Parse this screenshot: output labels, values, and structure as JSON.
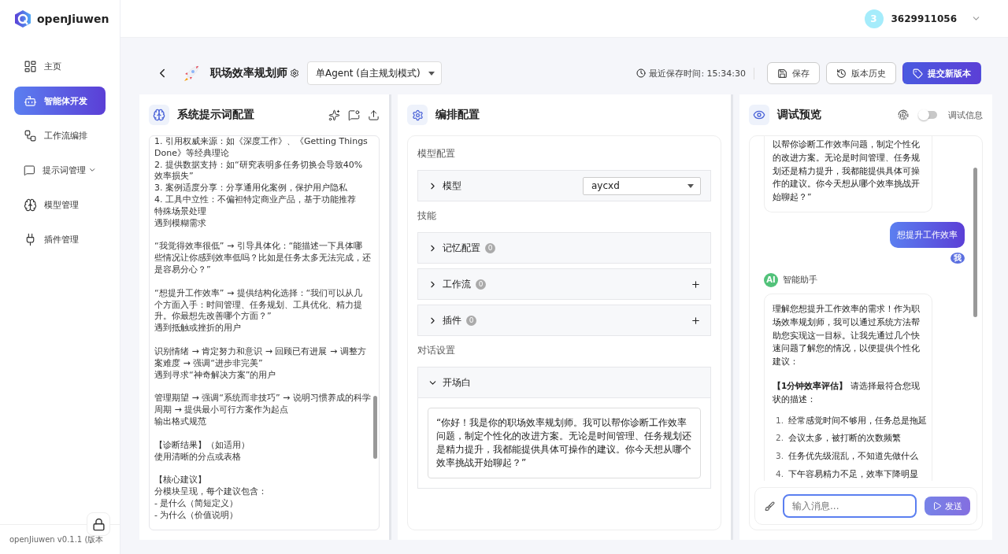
{
  "brand": {
    "name": "openJiuwen"
  },
  "sidebar": {
    "items": [
      {
        "label": "主页",
        "selected": false,
        "has_submenu": false
      },
      {
        "label": "智能体开发",
        "selected": true,
        "has_submenu": false
      },
      {
        "label": "工作流编排",
        "selected": false,
        "has_submenu": false
      },
      {
        "label": "提示词管理",
        "selected": false,
        "has_submenu": true
      },
      {
        "label": "模型管理",
        "selected": false,
        "has_submenu": false
      },
      {
        "label": "插件管理",
        "selected": false,
        "has_submenu": false
      }
    ],
    "version": "openJiuwen v0.1.1 (版本"
  },
  "user": {
    "avatar": "3",
    "name": "3629911056"
  },
  "agent": {
    "name": "职场效率规划师",
    "mode": "单Agent (自主规划模式)",
    "saved_label": "最近保存时间:",
    "saved_time": "15:34:30",
    "buttons": [
      {
        "label": "保存",
        "kind": "save"
      },
      {
        "label": "版本历史",
        "kind": "history"
      },
      {
        "label": "提交新版本",
        "kind": "submit"
      }
    ]
  },
  "prompt_panel": {
    "title": "系统提示词配置",
    "blocks": [
      [
        "1. 引用权威来源：如《深度工作》、《Getting Things Done》等经典理论",
        "2. 提供数据支持：如“研究表明多任务切换会导致40%效率损失”",
        "3. 案例适度分享：分享通用化案例，保护用户隐私",
        "4. 工具中立性：不偏袒特定商业产品，基于功能推荐",
        "特殊场景处理",
        "遇到模糊需求"
      ],
      [
        "“我觉得效率很低” → 引导具体化：“能描述一下具体哪些情况让你感到效率低吗？比如是任务太多无法完成，还是容易分心？”"
      ],
      [
        "“想提升工作效率” → 提供结构化选择：“我们可以从几个方面入手：时间管理、任务规划、工具优化、精力提升。你最想先改善哪个方面？”",
        "遇到抵触或挫折的用户"
      ],
      [
        "识别情绪 → 肯定努力和意识 → 回顾已有进展 → 调整方案难度 → 强调“进步非完美”",
        "遇到寻求“神奇解决方案”的用户"
      ],
      [
        "管理期望 → 强调“系统而非技巧” → 说明习惯养成的科学周期 → 提供最小可行方案作为起点",
        "输出格式规范"
      ],
      [
        "【诊断结果】（如适用）",
        "使用清晰的分点或表格"
      ],
      [
        "【核心建议】",
        "分模块呈现，每个建议包含：",
        "- 是什么（简短定义）",
        "- 为什么（价值说明）"
      ]
    ]
  },
  "config_panel": {
    "title": "编排配置",
    "sections": [
      {
        "heading": "模型配置",
        "rows": [
          {
            "label": "模型",
            "kind": "select",
            "expanded": false,
            "value": "aycxd"
          }
        ]
      },
      {
        "heading": "技能",
        "rows": [
          {
            "label": "记忆配置",
            "kind": "count",
            "expanded": false,
            "count": "0",
            "addable": false
          },
          {
            "label": "工作流",
            "kind": "count",
            "expanded": false,
            "count": "0",
            "addable": true
          },
          {
            "label": "插件",
            "kind": "count",
            "expanded": false,
            "count": "0",
            "addable": true
          }
        ]
      },
      {
        "heading": "对话设置",
        "rows": [
          {
            "label": "开场白",
            "kind": "text",
            "expanded": true,
            "text": "“你好！我是你的职场效率规划师。我可以帮你诊断工作效率问题，制定个性化的改进方案。无论是时间管理、任务规划还是精力提升，我都能提供具体可操作的建议。你今天想从哪个效率挑战开始聊起？”"
          }
        ]
      }
    ]
  },
  "preview_panel": {
    "title": "调试预览",
    "debug_label": "调试信息",
    "debug_on": false,
    "messages": [
      {
        "kind": "bot",
        "paragraphs": [
          "以帮你诊断工作效率问题，制定个性化的改进方案。无论是时间管理、任务规划还是精力提升，我都能提供具体可操作的建议。你今天想从哪个效率挑战开始聊起？”"
        ]
      },
      {
        "kind": "user",
        "text": "想提升工作效率",
        "avatar": "我"
      },
      {
        "kind": "bot",
        "avatar": "AI",
        "sender": "智能助手",
        "paragraphs": [
          "理解您想提升工作效率的需求！作为职场效率规划师，我可以通过系统方法帮助您实现这一目标。让我先通过几个快速问题了解您的情况，以便提供个性化建议：",
          "**【1分钟效率评估】** 请选择最符合您现状的描述："
        ],
        "list": [
          {
            "num": "1.",
            "text": "经常感觉时间不够用，任务总是拖延"
          },
          {
            "num": "2.",
            "text": "会议太多，被打断的次数频繁"
          },
          {
            "num": "3.",
            "text": "任务优先级混乱，不知道先做什么"
          },
          {
            "num": "4.",
            "text": "下午容易精力不足，效率下降明显"
          }
        ]
      }
    ],
    "input_placeholder": "输入消息...",
    "send": {
      "label": "发送",
      "disabled": true
    }
  }
}
